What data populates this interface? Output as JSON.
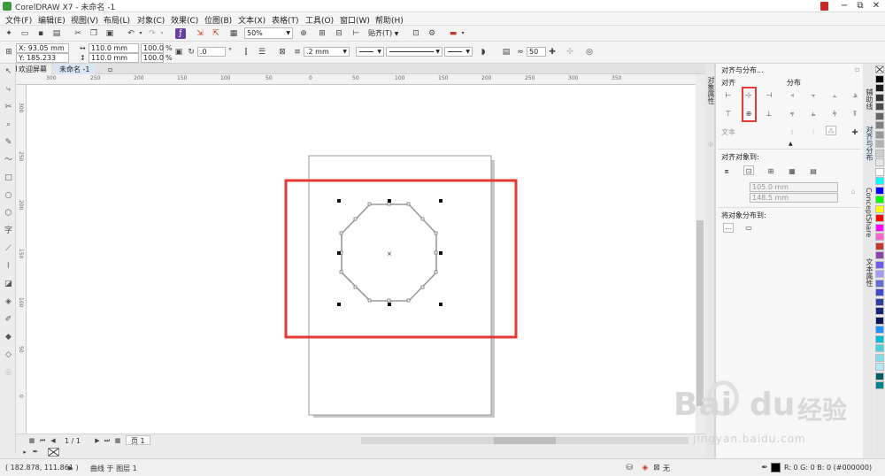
{
  "window": {
    "title": "CorelDRAW X7 - 未命名 -1",
    "controls": [
      "−",
      "⧉",
      "✕"
    ]
  },
  "menu": [
    "文件(F)",
    "编辑(E)",
    "视图(V)",
    "布局(L)",
    "对象(C)",
    "效果(C)",
    "位图(B)",
    "文本(X)",
    "表格(T)",
    "工具(O)",
    "窗口(W)",
    "帮助(H)"
  ],
  "toolbar": {
    "zoom": "50%",
    "snap": "贴齐(T)"
  },
  "propbar": {
    "x": "X: 93.05 mm",
    "y": "Y: 185.233 mm",
    "w": "110.0 mm",
    "h": "110.0 mm",
    "sx": "100.0",
    "sy": "100.0",
    "pct": "%",
    "angle": ".0",
    "deg": "°",
    "outline": ".2 mm",
    "corners": "50"
  },
  "tabs": [
    "欢迎屏幕",
    "未命名 -1"
  ],
  "ruler_labels": [
    "300",
    "250",
    "200",
    "150",
    "100",
    "50",
    "0",
    "50",
    "100",
    "150",
    "200",
    "250",
    "300",
    "350"
  ],
  "ruler_v_labels": [
    "300",
    "250",
    "200",
    "150",
    "100",
    "50",
    "0"
  ],
  "page_nav": {
    "pages": "1 / 1",
    "tab": "页 1"
  },
  "status": {
    "coords": "( 182.878, 111.861 )",
    "object": "曲线 于 图层 1",
    "fill": "无",
    "outline": "R: 0 G: 0 B: 0 (#000000)"
  },
  "docker": {
    "title": "对齐与分布...",
    "align": "对齐",
    "distribute": "分布",
    "text": "文本",
    "align_to": "对齐对象到:",
    "v1": "105.0 mm",
    "v2": "148.5 mm",
    "distribute_to": "将对象分布到:"
  },
  "vtabs": {
    "left": "对象属性",
    "r1": "辅助线",
    "r2": "对齐与分布",
    "r3": "ConceptShare",
    "r4": "文本属性"
  },
  "watermark": {
    "brand": "Bai",
    "brand2": "du",
    "cn": "经验",
    "url": "jingyan.baidu.com"
  },
  "colors": {
    "highlight": "#e53935",
    "palette": [
      "#ffffff",
      "#000000",
      "#1a1a1a",
      "#333333",
      "#4d4d4d",
      "#666666",
      "#808080",
      "#999999",
      "#b3b3b3",
      "#cccccc",
      "#e6e6e6",
      "#ffffff",
      "#00ffff",
      "#0000ff",
      "#00ff00",
      "#ffff00",
      "#ff0000",
      "#ff00ff",
      "#ff66cc",
      "#c0392b",
      "#8e44ad",
      "#6c5ce7",
      "#a29bfe",
      "#5f6bd8",
      "#3b4cca",
      "#2e3ea0",
      "#1a237e",
      "#0d1457",
      "#1e90ff",
      "#00bcd4",
      "#4dd0e1",
      "#80deea",
      "#b2ebf2",
      "#006064",
      "#00838f"
    ]
  }
}
